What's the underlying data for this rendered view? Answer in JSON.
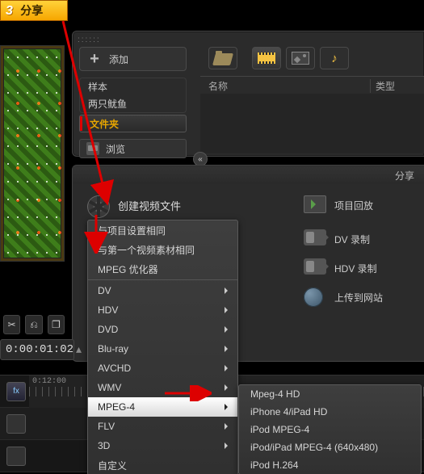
{
  "share_tag": {
    "num": "3",
    "label": "分享"
  },
  "sidebar": {
    "add": "添加",
    "sample": "样本",
    "squid": "两只鱿鱼",
    "folder": "文件夹",
    "browse": "浏览"
  },
  "listhead": {
    "name": "名称",
    "type": "类型"
  },
  "collapse": "«",
  "share_head": "分享",
  "actions": {
    "create": "创建视频文件",
    "replay": "项目回放",
    "dvrec": "DV 录制",
    "hdvrec": "HDV 录制",
    "upload": "上传到网站"
  },
  "menu1": [
    {
      "id": "same-project",
      "label": "与项目设置相同",
      "sub": false
    },
    {
      "id": "same-first",
      "label": "与第一个视频素材相同",
      "sub": false
    },
    {
      "id": "mpeg-opt",
      "label": "MPEG 优化器",
      "sub": false
    },
    {
      "id": "sep",
      "sep": true
    },
    {
      "id": "dv",
      "label": "DV",
      "sub": true
    },
    {
      "id": "hdv",
      "label": "HDV",
      "sub": true
    },
    {
      "id": "dvd",
      "label": "DVD",
      "sub": true
    },
    {
      "id": "bluray",
      "label": "Blu-ray",
      "sub": true
    },
    {
      "id": "avchd",
      "label": "AVCHD",
      "sub": true
    },
    {
      "id": "wmv",
      "label": "WMV",
      "sub": true
    },
    {
      "id": "mpeg4",
      "label": "MPEG-4",
      "sub": true,
      "hl": true
    },
    {
      "id": "flv",
      "label": "FLV",
      "sub": true
    },
    {
      "id": "3d",
      "label": "3D",
      "sub": true
    },
    {
      "id": "custom",
      "label": "自定义",
      "sub": false
    }
  ],
  "menu2": [
    {
      "id": "mp4hd",
      "label": "Mpeg-4 HD"
    },
    {
      "id": "iphone4",
      "label": "iPhone 4/iPad HD"
    },
    {
      "id": "ipodmp4",
      "label": "iPod MPEG-4"
    },
    {
      "id": "ipodipad",
      "label": "iPod/iPad MPEG-4 (640x480)"
    },
    {
      "id": "ipod264",
      "label": "iPod H.264"
    }
  ],
  "time": {
    "value": "0:00:01:02",
    "hot": "02"
  },
  "ruler": {
    "zero": "0:12:00"
  },
  "icons": {
    "cut": "✂",
    "split": "⎌",
    "copy": "❐"
  }
}
